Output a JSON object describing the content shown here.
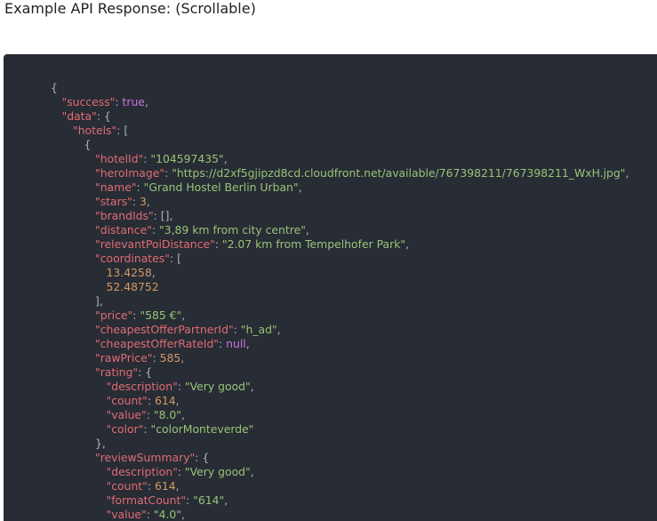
{
  "heading": "Example API Response: (Scrollable)",
  "code": {
    "lines": [
      {
        "indent": 0,
        "tokens": [
          {
            "t": "p",
            "v": "{"
          }
        ]
      },
      {
        "indent": 1,
        "tokens": [
          {
            "t": "k",
            "v": "\"success\""
          },
          {
            "t": "p",
            "v": ": "
          },
          {
            "t": "b",
            "v": "true"
          },
          {
            "t": "p",
            "v": ","
          }
        ]
      },
      {
        "indent": 1,
        "tokens": [
          {
            "t": "k",
            "v": "\"data\""
          },
          {
            "t": "p",
            "v": ": {"
          }
        ]
      },
      {
        "indent": 2,
        "tokens": [
          {
            "t": "k",
            "v": "\"hotels\""
          },
          {
            "t": "p",
            "v": ": ["
          }
        ]
      },
      {
        "indent": 3,
        "tokens": [
          {
            "t": "p",
            "v": "{"
          }
        ]
      },
      {
        "indent": 4,
        "tokens": [
          {
            "t": "k",
            "v": "\"hotelId\""
          },
          {
            "t": "p",
            "v": ": "
          },
          {
            "t": "s",
            "v": "\"104597435\""
          },
          {
            "t": "p",
            "v": ","
          }
        ]
      },
      {
        "indent": 4,
        "tokens": [
          {
            "t": "k",
            "v": "\"heroImage\""
          },
          {
            "t": "p",
            "v": ": "
          },
          {
            "t": "s",
            "v": "\"https://d2xf5gjipzd8cd.cloudfront.net/available/767398211/767398211_WxH.jpg\""
          },
          {
            "t": "p",
            "v": ","
          }
        ]
      },
      {
        "indent": 4,
        "tokens": [
          {
            "t": "k",
            "v": "\"name\""
          },
          {
            "t": "p",
            "v": ": "
          },
          {
            "t": "s",
            "v": "\"Grand Hostel Berlin Urban\""
          },
          {
            "t": "p",
            "v": ","
          }
        ]
      },
      {
        "indent": 4,
        "tokens": [
          {
            "t": "k",
            "v": "\"stars\""
          },
          {
            "t": "p",
            "v": ": "
          },
          {
            "t": "n",
            "v": "3"
          },
          {
            "t": "p",
            "v": ","
          }
        ]
      },
      {
        "indent": 4,
        "tokens": [
          {
            "t": "k",
            "v": "\"brandIds\""
          },
          {
            "t": "p",
            "v": ": [],"
          }
        ]
      },
      {
        "indent": 4,
        "tokens": [
          {
            "t": "k",
            "v": "\"distance\""
          },
          {
            "t": "p",
            "v": ": "
          },
          {
            "t": "s",
            "v": "\"3,89 km from city centre\""
          },
          {
            "t": "p",
            "v": ","
          }
        ]
      },
      {
        "indent": 4,
        "tokens": [
          {
            "t": "k",
            "v": "\"relevantPoiDistance\""
          },
          {
            "t": "p",
            "v": ": "
          },
          {
            "t": "s",
            "v": "\"2.07 km from Tempelhofer Park\""
          },
          {
            "t": "p",
            "v": ","
          }
        ]
      },
      {
        "indent": 4,
        "tokens": [
          {
            "t": "k",
            "v": "\"coordinates\""
          },
          {
            "t": "p",
            "v": ": ["
          }
        ]
      },
      {
        "indent": 5,
        "tokens": [
          {
            "t": "n",
            "v": "13.4258"
          },
          {
            "t": "p",
            "v": ","
          }
        ]
      },
      {
        "indent": 5,
        "tokens": [
          {
            "t": "n",
            "v": "52.48752"
          }
        ]
      },
      {
        "indent": 4,
        "tokens": [
          {
            "t": "p",
            "v": "],"
          }
        ]
      },
      {
        "indent": 4,
        "tokens": [
          {
            "t": "k",
            "v": "\"price\""
          },
          {
            "t": "p",
            "v": ": "
          },
          {
            "t": "s",
            "v": "\"585 €\""
          },
          {
            "t": "p",
            "v": ","
          }
        ]
      },
      {
        "indent": 4,
        "tokens": [
          {
            "t": "k",
            "v": "\"cheapestOfferPartnerId\""
          },
          {
            "t": "p",
            "v": ": "
          },
          {
            "t": "s",
            "v": "\"h_ad\""
          },
          {
            "t": "p",
            "v": ","
          }
        ]
      },
      {
        "indent": 4,
        "tokens": [
          {
            "t": "k",
            "v": "\"cheapestOfferRateId\""
          },
          {
            "t": "p",
            "v": ": "
          },
          {
            "t": "b",
            "v": "null"
          },
          {
            "t": "p",
            "v": ","
          }
        ]
      },
      {
        "indent": 4,
        "tokens": [
          {
            "t": "k",
            "v": "\"rawPrice\""
          },
          {
            "t": "p",
            "v": ": "
          },
          {
            "t": "n",
            "v": "585"
          },
          {
            "t": "p",
            "v": ","
          }
        ]
      },
      {
        "indent": 4,
        "tokens": [
          {
            "t": "k",
            "v": "\"rating\""
          },
          {
            "t": "p",
            "v": ": {"
          }
        ]
      },
      {
        "indent": 5,
        "tokens": [
          {
            "t": "k",
            "v": "\"description\""
          },
          {
            "t": "p",
            "v": ": "
          },
          {
            "t": "s",
            "v": "\"Very good\""
          },
          {
            "t": "p",
            "v": ","
          }
        ]
      },
      {
        "indent": 5,
        "tokens": [
          {
            "t": "k",
            "v": "\"count\""
          },
          {
            "t": "p",
            "v": ": "
          },
          {
            "t": "n",
            "v": "614"
          },
          {
            "t": "p",
            "v": ","
          }
        ]
      },
      {
        "indent": 5,
        "tokens": [
          {
            "t": "k",
            "v": "\"value\""
          },
          {
            "t": "p",
            "v": ": "
          },
          {
            "t": "s",
            "v": "\"8.0\""
          },
          {
            "t": "p",
            "v": ","
          }
        ]
      },
      {
        "indent": 5,
        "tokens": [
          {
            "t": "k",
            "v": "\"color\""
          },
          {
            "t": "p",
            "v": ": "
          },
          {
            "t": "s",
            "v": "\"colorMonteverde\""
          }
        ]
      },
      {
        "indent": 4,
        "tokens": [
          {
            "t": "p",
            "v": "},"
          }
        ]
      },
      {
        "indent": 4,
        "tokens": [
          {
            "t": "k",
            "v": "\"reviewSummary\""
          },
          {
            "t": "p",
            "v": ": {"
          }
        ]
      },
      {
        "indent": 5,
        "tokens": [
          {
            "t": "k",
            "v": "\"description\""
          },
          {
            "t": "p",
            "v": ": "
          },
          {
            "t": "s",
            "v": "\"Very good\""
          },
          {
            "t": "p",
            "v": ","
          }
        ]
      },
      {
        "indent": 5,
        "tokens": [
          {
            "t": "k",
            "v": "\"count\""
          },
          {
            "t": "p",
            "v": ": "
          },
          {
            "t": "n",
            "v": "614"
          },
          {
            "t": "p",
            "v": ","
          }
        ]
      },
      {
        "indent": 5,
        "tokens": [
          {
            "t": "k",
            "v": "\"formatCount\""
          },
          {
            "t": "p",
            "v": ": "
          },
          {
            "t": "s",
            "v": "\"614\""
          },
          {
            "t": "p",
            "v": ","
          }
        ]
      },
      {
        "indent": 5,
        "tokens": [
          {
            "t": "k",
            "v": "\"value\""
          },
          {
            "t": "p",
            "v": ": "
          },
          {
            "t": "s",
            "v": "\"4.0\""
          },
          {
            "t": "p",
            "v": ","
          }
        ]
      }
    ]
  },
  "colors": {
    "panel_bg": "#282c34",
    "key": "#e06c75",
    "string": "#98c379",
    "number": "#d19a66",
    "boolean_null": "#c678dd",
    "punctuation": "#abb2bf"
  }
}
